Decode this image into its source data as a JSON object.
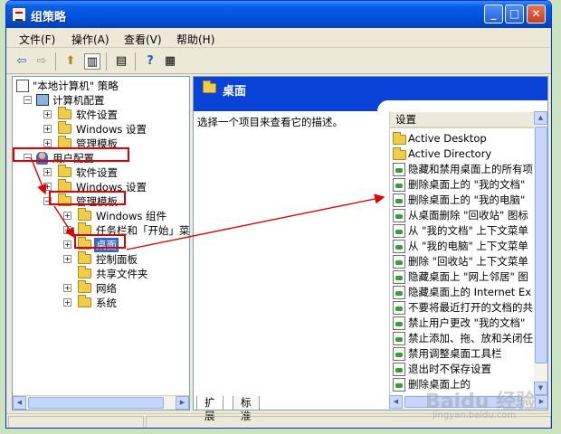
{
  "window": {
    "title": "组策略",
    "min_glyph": "_",
    "max_glyph": "□",
    "close_glyph": "✕"
  },
  "menu": [
    {
      "label": "文件(F)"
    },
    {
      "label": "操作(A)"
    },
    {
      "label": "查看(V)"
    },
    {
      "label": "帮助(H)"
    }
  ],
  "toolbar": {
    "back_glyph": "⇦",
    "forward_glyph": "⇨",
    "up_glyph": "⬆",
    "tree_glyph": "▥",
    "export_glyph": "▤",
    "help_glyph": "?",
    "props_glyph": "▦"
  },
  "tree": {
    "root": "\"本地计算机\" 策略",
    "computer_config": "计算机配置",
    "cc_software": "软件设置",
    "cc_windows": "Windows 设置",
    "cc_admin": "管理模板",
    "user_config": "用户配置",
    "uc_software": "软件设置",
    "uc_windows": "Windows 设置",
    "uc_admin": "管理模板",
    "windows_components": "Windows 组件",
    "taskbar": "任务栏和「开始」菜",
    "desktop": "桌面",
    "control_panel": "控制面板",
    "shared_folders": "共享文件夹",
    "network": "网络",
    "system": "系统",
    "expand_plus": "+",
    "expand_minus": "−"
  },
  "right": {
    "header_title": "桌面",
    "description": "选择一个项目来查看它的描述。",
    "column_header": "设置",
    "items": [
      {
        "label": "Active Desktop",
        "icon": "folder"
      },
      {
        "label": "Active Directory",
        "icon": "folder"
      },
      {
        "label": "隐藏和禁用桌面上的所有项",
        "icon": "setting"
      },
      {
        "label": "删除桌面上的 \"我的文档\"",
        "icon": "setting"
      },
      {
        "label": "删除桌面上的 \"我的电脑\"",
        "icon": "setting"
      },
      {
        "label": "从桌面删除 \"回收站\" 图标",
        "icon": "setting"
      },
      {
        "label": "从 \"我的文档\" 上下文菜单",
        "icon": "setting"
      },
      {
        "label": "从 \"我的电脑\" 上下文菜单",
        "icon": "setting"
      },
      {
        "label": "删除 \"回收站\" 上下文菜单",
        "icon": "setting"
      },
      {
        "label": "隐藏桌面上 \"网上邻居\" 图",
        "icon": "setting"
      },
      {
        "label": "隐藏桌面上的 Internet Ex",
        "icon": "setting"
      },
      {
        "label": "不要将最近打开的文档的共",
        "icon": "setting"
      },
      {
        "label": "禁止用户更改 \"我的文档\"",
        "icon": "setting"
      },
      {
        "label": "禁止添加、拖、放和关闭任",
        "icon": "setting"
      },
      {
        "label": "禁用调整桌面工具栏",
        "icon": "setting"
      },
      {
        "label": "退出时不保存设置",
        "icon": "setting"
      },
      {
        "label": "删除桌面上的",
        "icon": "setting"
      }
    ]
  },
  "tabs": [
    {
      "label": "扩展"
    },
    {
      "label": "标准"
    }
  ],
  "watermark": {
    "text": "Baidu 经验",
    "sub": "jingyan.baidu.com"
  },
  "colors": {
    "title_bar": "#0054e3",
    "pane_header": "#0842d6",
    "highlight": "#e00000"
  }
}
